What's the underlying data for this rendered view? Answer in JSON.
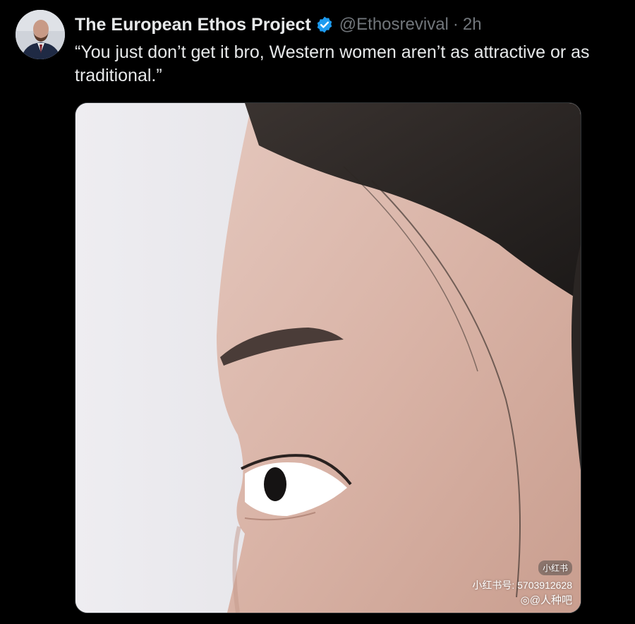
{
  "tweet": {
    "display_name": "The European Ethos Project",
    "handle": "@Ethosrevival",
    "separator": "·",
    "time": "2h",
    "text": "“You just don’t get it bro, Western women aren’t as attractive or as traditional.”",
    "verified_icon": "verified-badge-icon",
    "verified_color": "#1d9bf0"
  },
  "media": {
    "watermark": {
      "logo": "小红书",
      "id_text": "小红书号: 5703912628",
      "source_text": "◎@人种吧"
    }
  }
}
